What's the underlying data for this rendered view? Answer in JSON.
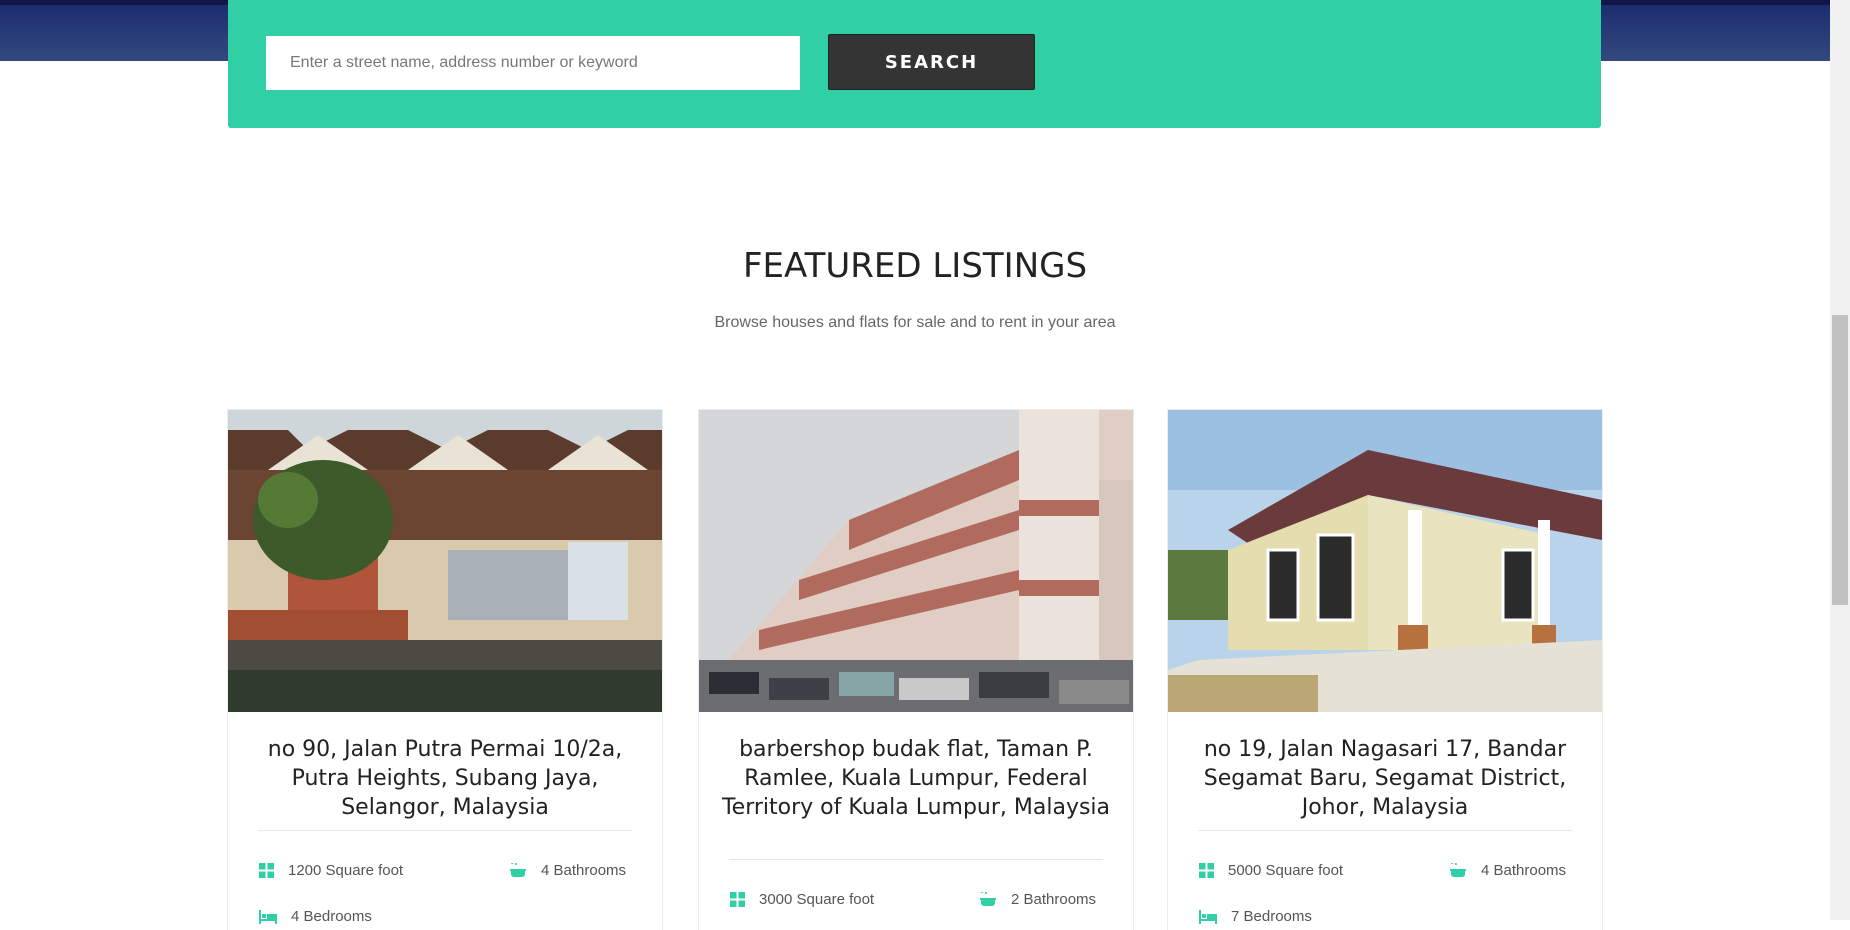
{
  "search": {
    "placeholder": "Enter a street name, address number or keyword",
    "button_label": "SEARCH"
  },
  "section": {
    "title": "FEATURED LISTINGS",
    "subtitle": "Browse houses and flats for sale and to rent in your area"
  },
  "listings": [
    {
      "title": "no 90, Jalan Putra Permai 10/2a, Putra Heights, Subang Jaya, Selangor, Malaysia",
      "area": "1200 Square foot",
      "bathrooms": "4 Bathrooms",
      "bedrooms": "4 Bedrooms"
    },
    {
      "title": "barbershop budak flat, Taman P. Ramlee, Kuala Lumpur, Federal Territory of Kuala Lumpur, Malaysia",
      "area": "3000 Square foot",
      "bathrooms": "2 Bathrooms"
    },
    {
      "title": "no 19, Jalan Nagasari 17, Bandar Segamat Baru, Segamat District, Johor, Malaysia",
      "area": "5000 Square foot",
      "bathrooms": "4 Bathrooms",
      "bedrooms": "7 Bedrooms"
    }
  ],
  "colors": {
    "accent": "#31cfa6",
    "button": "#343434",
    "hero": "#1a2a6e"
  },
  "icons": {
    "area": "grid-icon",
    "bathrooms": "bathtub-icon",
    "bedrooms": "bed-icon"
  }
}
